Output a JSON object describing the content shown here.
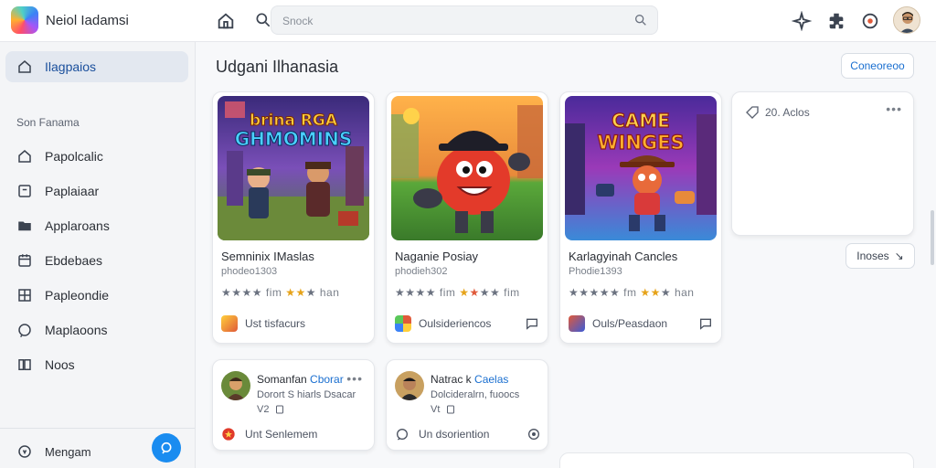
{
  "app": {
    "name": "Neiol Iadamsi"
  },
  "search": {
    "placeholder": "Snock"
  },
  "sidebar": {
    "active_item": "Ilagpaios",
    "section_title": "Son Fanama",
    "items": [
      {
        "label": "Papolcalic",
        "icon": "home-icon"
      },
      {
        "label": "Paplaiaar",
        "icon": "square-icon"
      },
      {
        "label": "Applaroans",
        "icon": "folder-icon"
      },
      {
        "label": "Ebdebaes",
        "icon": "calendar-icon"
      },
      {
        "label": "Papleondie",
        "icon": "grid-icon"
      },
      {
        "label": "Maplaoons",
        "icon": "chat-bubble-icon"
      },
      {
        "label": "Noos",
        "icon": "book-icon"
      }
    ],
    "footer_label": "Mengam"
  },
  "main": {
    "title": "Udgani Ilhanasia",
    "top_action": "Coneoreoo",
    "more_button": "Inoses",
    "games": [
      {
        "thumb_text": [
          "brina RGA",
          "GHMOMINS"
        ],
        "title": "Semninix IMaslas",
        "subtitle": "phodeo1303",
        "rating_label": "fim",
        "rating_tail": "han",
        "footer": "Ust tisfacurs"
      },
      {
        "thumb_text": [],
        "title": "Naganie Posiay",
        "subtitle": "phodieh302",
        "rating_label": "fim",
        "rating_tail": "fim",
        "footer": "Oulsideriencos"
      },
      {
        "thumb_text": [
          "CAME",
          "WINGES"
        ],
        "title": "Karlagyinah Cancles",
        "subtitle": "Phodie1393",
        "rating_label": "fm",
        "rating_tail": "han",
        "footer": "Ouls/Peasdaon"
      }
    ],
    "side_card": {
      "header": "20. Aclos"
    },
    "posts": [
      {
        "name": "Somanfan",
        "link": "Cborar",
        "text": "Dorort S hiarls Dsacar",
        "meta": "V2",
        "footer": "Unt Senlemem"
      },
      {
        "name": "Natrac k",
        "link": "Caelas",
        "text": "Dolcideralrn, fuoocs",
        "meta": "Vt",
        "footer": "Un dsoriention"
      }
    ]
  },
  "colors": {
    "accent": "#1a8cf0",
    "link": "#1a6fd0",
    "star": "#e6a31a"
  }
}
